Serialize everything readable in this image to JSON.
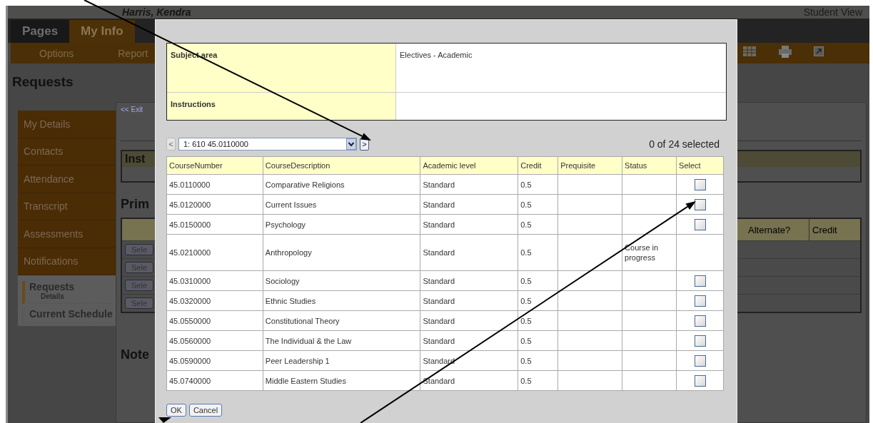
{
  "header": {
    "user_name": "Harris, Kendra",
    "view_label": "Student View"
  },
  "tabs": [
    {
      "label": "Pages",
      "selected": false
    },
    {
      "label": "My Info",
      "selected": true
    }
  ],
  "subnav": [
    "Options",
    "Report"
  ],
  "page_title": "Requests",
  "sidebar": {
    "items": [
      {
        "label": "My Details",
        "kind": "menu"
      },
      {
        "label": "Contacts",
        "kind": "menu"
      },
      {
        "label": "Attendance",
        "kind": "menu"
      },
      {
        "label": "Transcript",
        "kind": "menu"
      },
      {
        "label": "Assessments",
        "kind": "menu"
      },
      {
        "label": "Notifications",
        "kind": "menu"
      },
      {
        "label": "Requests",
        "kind": "link",
        "selected": true,
        "children": [
          {
            "label": "Details"
          }
        ]
      },
      {
        "label": "Current Schedule",
        "kind": "link",
        "selected": false
      }
    ]
  },
  "content": {
    "exit_link": "<< Exit",
    "instructions_heading": "Inst",
    "primary_heading": "Prim",
    "primary_table": {
      "columns": [
        "Alternate?",
        "Credit"
      ],
      "row_buttons": [
        "Sele",
        "Sele",
        "Sele",
        "Sele"
      ]
    },
    "notes_heading": "Note"
  },
  "dialog": {
    "info": [
      {
        "label": "Subject area",
        "value": "Electives - Academic"
      },
      {
        "label": "Instructions"
      }
    ],
    "pager": {
      "prev": "<",
      "next": ">",
      "prev_disabled": true,
      "value": "1: 610 45.0110000",
      "count": "0 of 24 selected"
    },
    "table": {
      "columns": [
        "CourseNumber",
        "CourseDescription",
        "Academic level",
        "Credit",
        "Prequisite",
        "Status",
        "Select"
      ],
      "rows": [
        {
          "cells": [
            "45.0110000",
            "Comparative Religions",
            "Standard",
            "0.5",
            "",
            ""
          ],
          "selectable": true,
          "checked": false
        },
        {
          "cells": [
            "45.0120000",
            "Current Issues",
            "Standard",
            "0.5",
            "",
            ""
          ],
          "selectable": true,
          "checked": false
        },
        {
          "cells": [
            "45.0150000",
            "Psychology",
            "Standard",
            "0.5",
            "",
            ""
          ],
          "selectable": true,
          "checked": false
        },
        {
          "cells": [
            "45.0210000",
            "Anthropology",
            "Standard",
            "0.5",
            "",
            "Course in progress"
          ],
          "selectable": false
        },
        {
          "cells": [
            "45.0310000",
            "Sociology",
            "Standard",
            "0.5",
            "",
            ""
          ],
          "selectable": true,
          "checked": false
        },
        {
          "cells": [
            "45.0320000",
            "Ethnic Studies",
            "Standard",
            "0.5",
            "",
            ""
          ],
          "selectable": true,
          "checked": false
        },
        {
          "cells": [
            "45.0550000",
            "Constitutional Theory",
            "Standard",
            "0.5",
            "",
            ""
          ],
          "selectable": true,
          "checked": false
        },
        {
          "cells": [
            "45.0560000",
            "The Individual & the Law",
            "Standard",
            "0.5",
            "",
            ""
          ],
          "selectable": true,
          "checked": false
        },
        {
          "cells": [
            "45.0590000",
            "Peer Leadership 1",
            "Standard",
            "0.5",
            "",
            ""
          ],
          "selectable": true,
          "checked": false
        },
        {
          "cells": [
            "45.0740000",
            "Middle Eastern Studies",
            "Standard",
            "0.5",
            "",
            ""
          ],
          "selectable": true,
          "checked": false
        }
      ]
    },
    "buttons": [
      "OK",
      "Cancel"
    ]
  }
}
